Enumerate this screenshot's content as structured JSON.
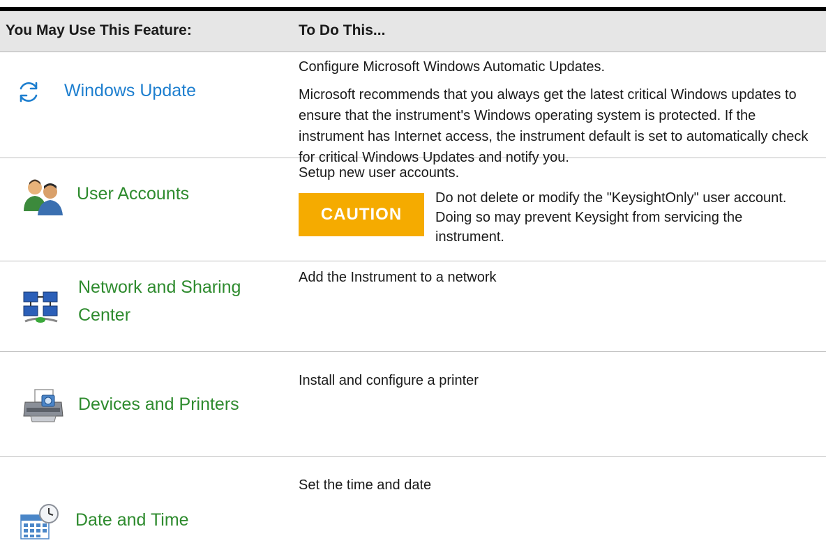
{
  "header": {
    "col1": "You May Use This Feature:",
    "col2": "To Do This..."
  },
  "rows": [
    {
      "label": "Windows Update",
      "icon": "refresh-icon",
      "desc1": "Configure Microsoft Windows Automatic Updates.",
      "desc2": "Microsoft recommends that you always get the latest critical Windows updates to ensure that the instrument's Windows operating system is protected. If the instrument has Internet access, the instrument default is set to automatically check for critical Windows Updates and notify you."
    },
    {
      "label": "User Accounts",
      "icon": "users-icon",
      "desc1": "Setup new user accounts.",
      "caution_label": "CAUTION",
      "caution_text": "Do not delete or modify the  \"KeysightOnly\" user account. Doing so may prevent Keysight from servicing the instrument."
    },
    {
      "label_line1": "Network and Sharing",
      "label_line2": "Center",
      "icon": "network-icon",
      "desc1": "Add the Instrument to a network"
    },
    {
      "label": "Devices and Printers",
      "icon": "printer-icon",
      "desc1": "Install and configure a printer"
    },
    {
      "label": "Date and Time",
      "icon": "calendar-clock-icon",
      "desc1": "Set the time and date"
    }
  ],
  "colors": {
    "blue_label": "#1e7fcf",
    "green_label": "#2e8b2e",
    "caution": "#f5ab00"
  }
}
